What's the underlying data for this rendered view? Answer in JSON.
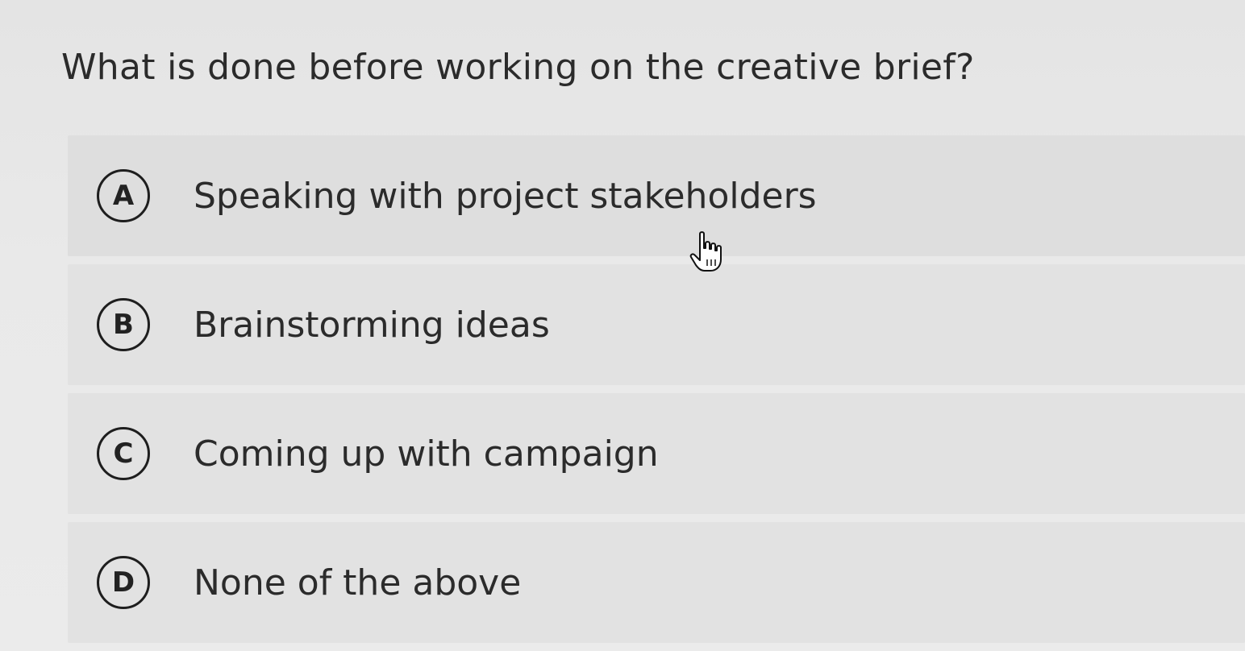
{
  "question": {
    "text": "What is done before working on the creative brief?"
  },
  "options": [
    {
      "letter": "A",
      "text": "Speaking with project stakeholders"
    },
    {
      "letter": "B",
      "text": "Brainstorming ideas"
    },
    {
      "letter": "C",
      "text": "Coming up with campaign"
    },
    {
      "letter": "D",
      "text": "None of the above"
    }
  ],
  "cursor": {
    "icon": "hand-pointer-icon"
  }
}
